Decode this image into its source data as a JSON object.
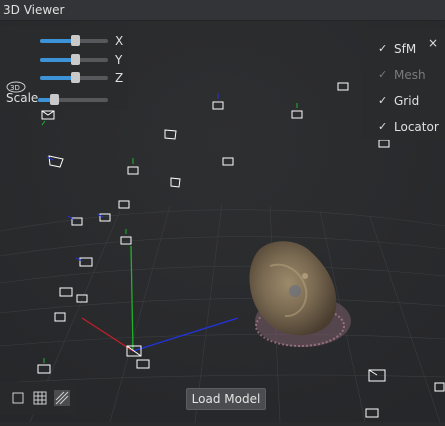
{
  "window": {
    "title": "3D Viewer"
  },
  "transform": {
    "x_label": "X",
    "y_label": "Y",
    "z_label": "Z",
    "x_value": 0.5,
    "y_value": 0.5,
    "z_value": 0.5,
    "scale_label": "Scale",
    "scale_value": 0.2,
    "rotation_icon": "3d-rotate-icon",
    "rotation_icon_text": "3D"
  },
  "layers": {
    "items": [
      {
        "label": "SfM",
        "checked": true,
        "enabled": true
      },
      {
        "label": "Mesh",
        "checked": true,
        "enabled": false
      },
      {
        "label": "Grid",
        "checked": true,
        "enabled": true
      },
      {
        "label": "Locator",
        "checked": true,
        "enabled": true
      }
    ],
    "check_glyph": "✓",
    "close_glyph": "×"
  },
  "bottom_toolbar": {
    "tools": [
      "single-view-icon",
      "grid-view-icon",
      "hatched-view-icon"
    ]
  },
  "load_model_label": "Load Model",
  "colors": {
    "accent": "#3d93d8",
    "axis_x": "#c0202a",
    "axis_y": "#1fb12a",
    "axis_z": "#2233dd"
  }
}
